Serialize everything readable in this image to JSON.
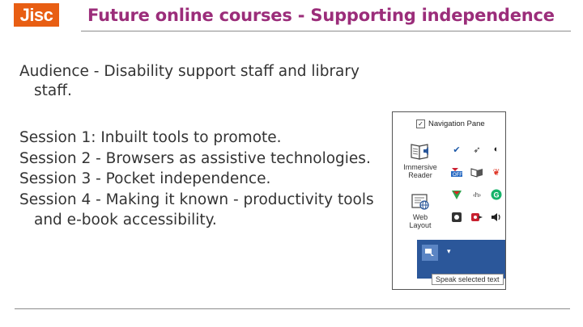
{
  "header": {
    "logo": "Jisc",
    "title": "Future online courses - Supporting independence",
    "title_color": "#9b2d7a",
    "logo_color": "#e85e13"
  },
  "audience": "Audience - Disability support staff and library staff.",
  "sessions": [
    "Session 1: Inbuilt tools to promote.",
    "Session 2 - Browsers as assistive technologies.",
    "Session 3 - Pocket independence.",
    "Session 4 - Making it known - productivity tools and e-book accessibility."
  ],
  "screenshot": {
    "navigation_pane_label": "Navigation Pane",
    "navigation_pane_checked": true,
    "immersive_reader_label": "Immersive Reader",
    "web_layout_label": "Web Layout",
    "speak_tooltip": "Speak selected text",
    "icons": [
      "checkmark-icon",
      "rocket-icon",
      "moon-icon",
      "off-toggle-icon",
      "book-icon",
      "balloon-icon",
      "shield-icon",
      "code-icon",
      "grammarly-icon",
      "camera-icon",
      "lastpass-icon",
      "speaker-icon",
      "speak-selected-text-icon"
    ]
  }
}
